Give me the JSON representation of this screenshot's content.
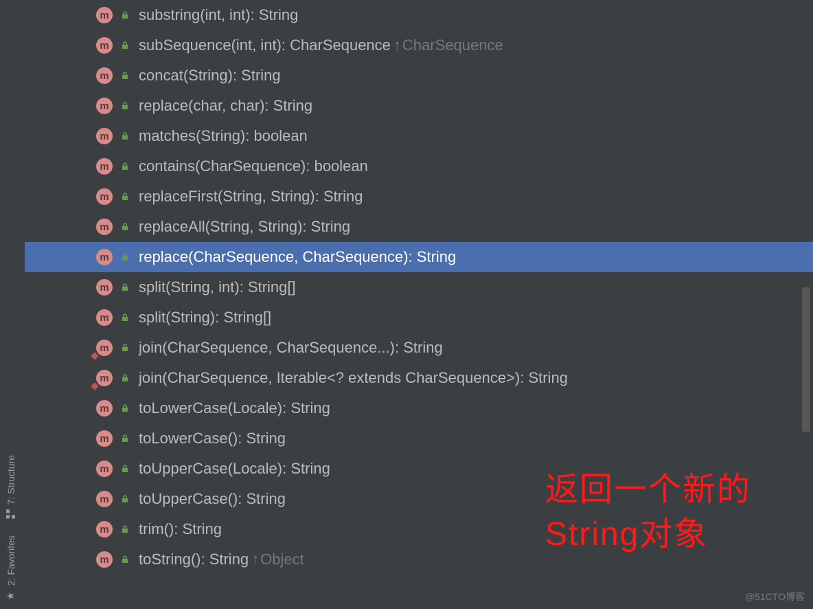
{
  "sidebar": {
    "structure": {
      "label": "7: Structure"
    },
    "favorites": {
      "label": "2: Favorites"
    }
  },
  "methods": [
    {
      "name": "substring(int, int): String",
      "selected": false,
      "static": false,
      "inherited": ""
    },
    {
      "name": "subSequence(int, int): CharSequence",
      "selected": false,
      "static": false,
      "inherited": "CharSequence"
    },
    {
      "name": "concat(String): String",
      "selected": false,
      "static": false,
      "inherited": ""
    },
    {
      "name": "replace(char, char): String",
      "selected": false,
      "static": false,
      "inherited": ""
    },
    {
      "name": "matches(String): boolean",
      "selected": false,
      "static": false,
      "inherited": ""
    },
    {
      "name": "contains(CharSequence): boolean",
      "selected": false,
      "static": false,
      "inherited": ""
    },
    {
      "name": "replaceFirst(String, String): String",
      "selected": false,
      "static": false,
      "inherited": ""
    },
    {
      "name": "replaceAll(String, String): String",
      "selected": false,
      "static": false,
      "inherited": ""
    },
    {
      "name": "replace(CharSequence, CharSequence): String",
      "selected": true,
      "static": false,
      "inherited": ""
    },
    {
      "name": "split(String, int): String[]",
      "selected": false,
      "static": false,
      "inherited": ""
    },
    {
      "name": "split(String): String[]",
      "selected": false,
      "static": false,
      "inherited": ""
    },
    {
      "name": "join(CharSequence, CharSequence...): String",
      "selected": false,
      "static": true,
      "inherited": ""
    },
    {
      "name": "join(CharSequence, Iterable<? extends CharSequence>): String",
      "selected": false,
      "static": true,
      "inherited": ""
    },
    {
      "name": "toLowerCase(Locale): String",
      "selected": false,
      "static": false,
      "inherited": ""
    },
    {
      "name": "toLowerCase(): String",
      "selected": false,
      "static": false,
      "inherited": ""
    },
    {
      "name": "toUpperCase(Locale): String",
      "selected": false,
      "static": false,
      "inherited": ""
    },
    {
      "name": "toUpperCase(): String",
      "selected": false,
      "static": false,
      "inherited": ""
    },
    {
      "name": "trim(): String",
      "selected": false,
      "static": false,
      "inherited": ""
    },
    {
      "name": "toString(): String",
      "selected": false,
      "static": false,
      "inherited": "Object"
    }
  ],
  "annotation": {
    "line1": "返回一个新的",
    "line2": "String对象"
  },
  "watermark": "@51CTO博客",
  "icons": {
    "method_letter": "m"
  }
}
